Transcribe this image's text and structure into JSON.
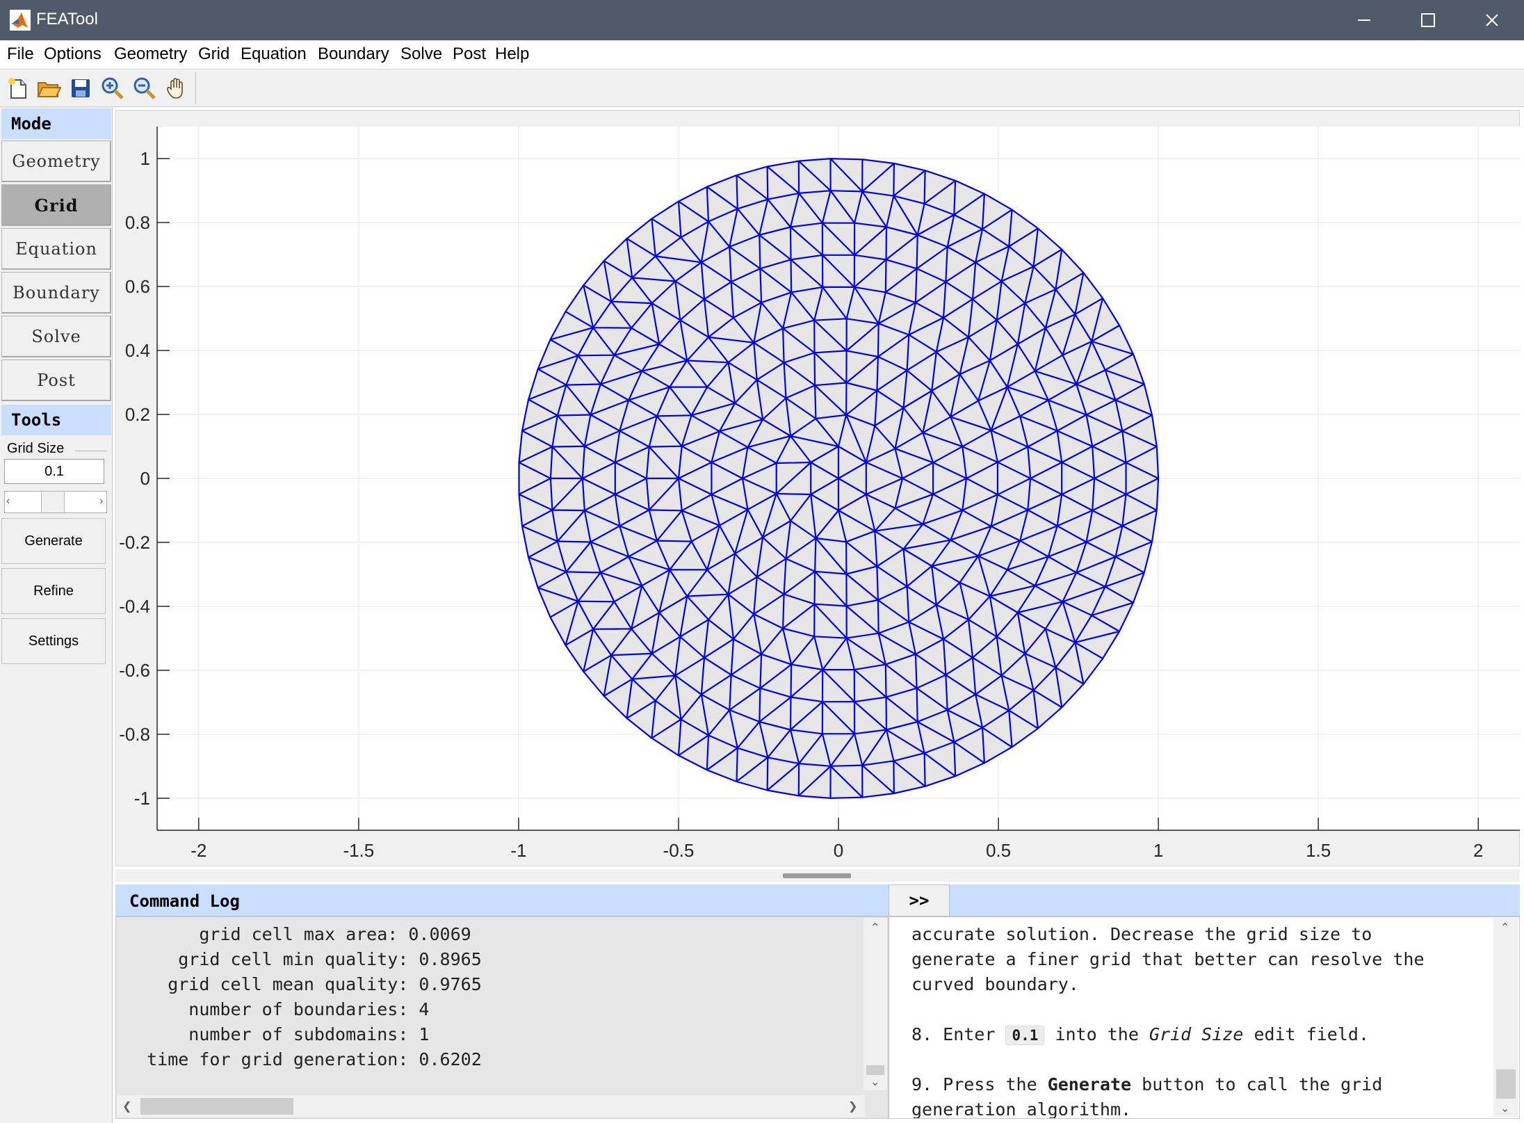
{
  "window": {
    "title": "FEATool"
  },
  "menu": [
    "File",
    "Options",
    "Geometry",
    "Grid",
    "Equation",
    "Boundary",
    "Solve",
    "Post",
    "Help"
  ],
  "toolbar": [
    "new-file-icon",
    "open-folder-icon",
    "save-icon",
    "zoom-in-icon",
    "zoom-out-icon",
    "pan-hand-icon"
  ],
  "mode_panel": {
    "header": "Mode",
    "buttons": [
      "Geometry",
      "Grid",
      "Equation",
      "Boundary",
      "Solve",
      "Post"
    ],
    "active": "Grid"
  },
  "tools_panel": {
    "header": "Tools",
    "grid_size_label": "Grid Size",
    "grid_size_value": "0.1",
    "buttons": [
      "Generate",
      "Refine",
      "Settings"
    ]
  },
  "chart_data": {
    "type": "mesh",
    "shape": "circle",
    "center": [
      0,
      0
    ],
    "radius": 1,
    "grid_size": 0.1,
    "mesh_color": "#0000ee",
    "fill_color": "#e6e6e6",
    "xlim": [
      -2.13,
      2.13
    ],
    "ylim": [
      -1.1,
      1.1
    ],
    "xticks": [
      -2,
      -1.5,
      -1,
      -0.5,
      0,
      0.5,
      1,
      1.5,
      2
    ],
    "xtick_labels": [
      "-2",
      "-1.5",
      "-1",
      "-0.5",
      "0",
      "0.5",
      "1",
      "1.5",
      "2"
    ],
    "yticks": [
      1,
      0.8,
      0.6,
      0.4,
      0.2,
      0,
      -0.2,
      -0.4,
      -0.6,
      -0.8,
      -1
    ],
    "ytick_labels": [
      "1",
      "0.8",
      "0.6",
      "0.4",
      "0.2",
      "0",
      "-0.2",
      "-0.4",
      "-0.6",
      "-0.8",
      "-1"
    ],
    "grid": true
  },
  "command_log": {
    "header": "Command Log",
    "lines": [
      "       grid cell max area: 0.0069",
      "     grid cell min quality: 0.8965",
      "    grid cell mean quality: 0.9765",
      "      number of boundaries: 4",
      "      number of subdomains: 1",
      "  time for grid generation: 0.6202"
    ]
  },
  "expand_button": {
    "label": ">>"
  },
  "help": {
    "lines": [
      "accurate solution. Decrease the grid size to",
      "generate a finer grid that better can resolve the",
      "curved boundary."
    ],
    "step8": {
      "pre": "8. Enter ",
      "code": "0.1",
      "mid": " into the ",
      "em": "Grid Size",
      "post": " edit field."
    },
    "step9": {
      "pre": "9. Press the ",
      "strong": "Generate",
      "post": " button to call the grid",
      "line2": "generation algorithm."
    }
  }
}
